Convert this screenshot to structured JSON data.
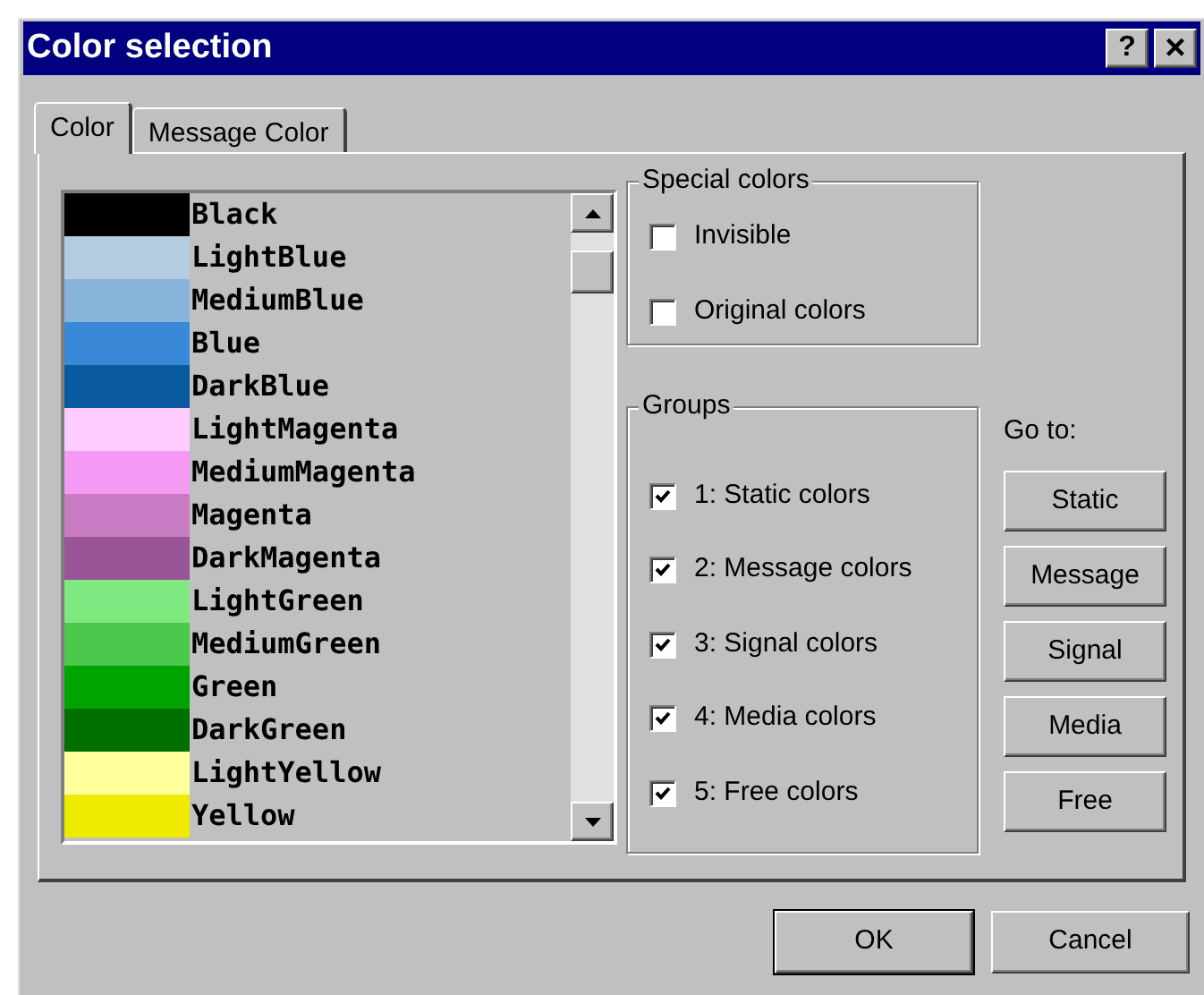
{
  "window": {
    "title": "Color selection",
    "help_button": "?",
    "close_button": "×"
  },
  "tabs": [
    {
      "label": "Color",
      "selected": true
    },
    {
      "label": "Message Color",
      "selected": false
    }
  ],
  "colors": [
    {
      "name": "Black",
      "color": "#000000"
    },
    {
      "name": "LightBlue",
      "color": "#b4cce0"
    },
    {
      "name": "MediumBlue",
      "color": "#88b4dc"
    },
    {
      "name": "Blue",
      "color": "#3a88d8"
    },
    {
      "name": "DarkBlue",
      "color": "#0a5aa0"
    },
    {
      "name": "LightMagenta",
      "color": "#ffccff"
    },
    {
      "name": "MediumMagenta",
      "color": "#f49af4"
    },
    {
      "name": "Magenta",
      "color": "#c87cc4"
    },
    {
      "name": "DarkMagenta",
      "color": "#9a5498"
    },
    {
      "name": "LightGreen",
      "color": "#80e880"
    },
    {
      "name": "MediumGreen",
      "color": "#4cc84c"
    },
    {
      "name": "Green",
      "color": "#00a400"
    },
    {
      "name": "DarkGreen",
      "color": "#007000"
    },
    {
      "name": "LightYellow",
      "color": "#ffff9c"
    },
    {
      "name": "Yellow",
      "color": "#eeea00"
    }
  ],
  "special_colors": {
    "title": "Special colors",
    "options": [
      {
        "label": "Invisible",
        "checked": false
      },
      {
        "label": "Original colors",
        "checked": false
      }
    ]
  },
  "groups": {
    "title": "Groups",
    "options": [
      {
        "label": "1: Static colors",
        "checked": true
      },
      {
        "label": "2: Message colors",
        "checked": true
      },
      {
        "label": "3: Signal colors",
        "checked": true
      },
      {
        "label": "4: Media colors",
        "checked": true
      },
      {
        "label": "5: Free colors",
        "checked": true
      }
    ]
  },
  "go_to": {
    "label": "Go to:",
    "buttons": [
      "Static",
      "Message",
      "Signal",
      "Media",
      "Free"
    ]
  },
  "footer_buttons": [
    {
      "label": "OK",
      "default": true
    },
    {
      "label": "Cancel",
      "default": false
    }
  ]
}
